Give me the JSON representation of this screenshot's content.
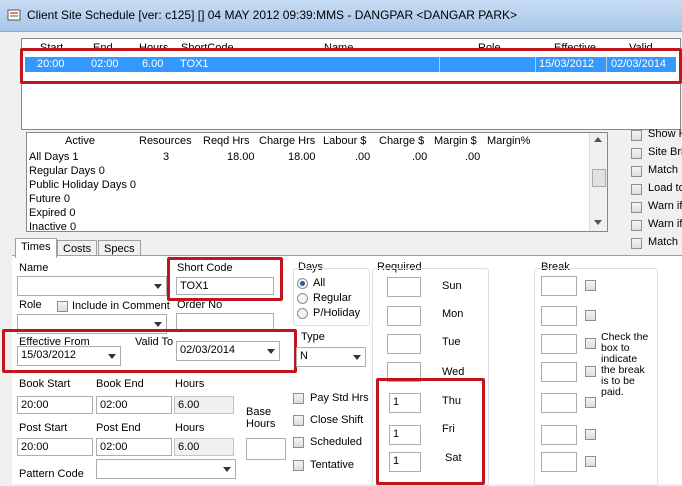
{
  "window": {
    "title": "Client Site Schedule [ver: c125] [] 04 MAY 2012 09:39:MMS - DANGPAR <DANGAR PARK>"
  },
  "schedule_grid": {
    "columns": [
      "Start",
      "End",
      "Hours",
      "ShortCode",
      "Name",
      "Role",
      "Effective",
      "Valid"
    ],
    "row": {
      "start": "20:00",
      "end": "02:00",
      "hours": "6.00",
      "shortcode": "TOX1",
      "name": "",
      "role": "",
      "effective": "15/03/2012",
      "valid": "02/03/2014"
    }
  },
  "summary_grid": {
    "columns": [
      "Active",
      "Resources",
      "Reqd Hrs",
      "Charge Hrs",
      "Labour $",
      "Charge $",
      "Margin $",
      "Margin%"
    ],
    "rows": [
      {
        "active": "All Days 1",
        "resources": "3",
        "reqd": "18.00",
        "charge_hrs": "18.00",
        "labour": ".00",
        "charge": ".00",
        "margin": ".00",
        "margin_pct": ""
      },
      {
        "active": "Regular Days 0"
      },
      {
        "active": "Public Holiday Days 0"
      },
      {
        "active": "Future 0"
      },
      {
        "active": "Expired 0"
      },
      {
        "active": "Inactive 0"
      }
    ]
  },
  "right_options": [
    "Show H",
    "Site Bri",
    "Match",
    "Load to",
    "Warn if",
    "Warn if",
    "Match"
  ],
  "tabs": [
    "Times",
    "Costs",
    "Specs"
  ],
  "form": {
    "name_label": "Name",
    "role_label": "Role",
    "include_in_comment": "Include in Comment",
    "short_code_label": "Short Code",
    "short_code_value": "TOX1",
    "order_no_label": "Order No",
    "effective_from_label": "Effective From",
    "effective_from_value": "15/03/2012",
    "valid_to_label": "Valid To",
    "valid_to_value": "02/03/2014",
    "days_label": "Days",
    "days_options": [
      "All",
      "Regular",
      "P/Holiday"
    ],
    "type_label": "Type",
    "type_value": "N",
    "book_start_label": "Book Start",
    "book_start_value": "20:00",
    "book_end_label": "Book End",
    "book_end_value": "02:00",
    "book_hours_label": "Hours",
    "book_hours_value": "6.00",
    "post_start_label": "Post Start",
    "post_start_value": "20:00",
    "post_end_label": "Post End",
    "post_end_value": "02:00",
    "post_hours_label": "Hours",
    "post_hours_value": "6.00",
    "base_hours_label_1": "Base",
    "base_hours_label_2": "Hours",
    "pattern_code_label": "Pattern Code",
    "checks": [
      "Pay Std Hrs",
      "Close Shift",
      "Scheduled",
      "Tentative"
    ]
  },
  "required": {
    "label": "Required",
    "days": [
      {
        "day": "Sun",
        "value": ""
      },
      {
        "day": "Mon",
        "value": ""
      },
      {
        "day": "Tue",
        "value": ""
      },
      {
        "day": "Wed",
        "value": ""
      },
      {
        "day": "Thu",
        "value": "1"
      },
      {
        "day": "Fri",
        "value": "1"
      },
      {
        "day": "Sat",
        "value": "1"
      }
    ]
  },
  "break": {
    "label": "Break",
    "note_lines": [
      "Check the",
      "box to",
      "indicate",
      "the break",
      "is to be",
      "paid."
    ]
  }
}
